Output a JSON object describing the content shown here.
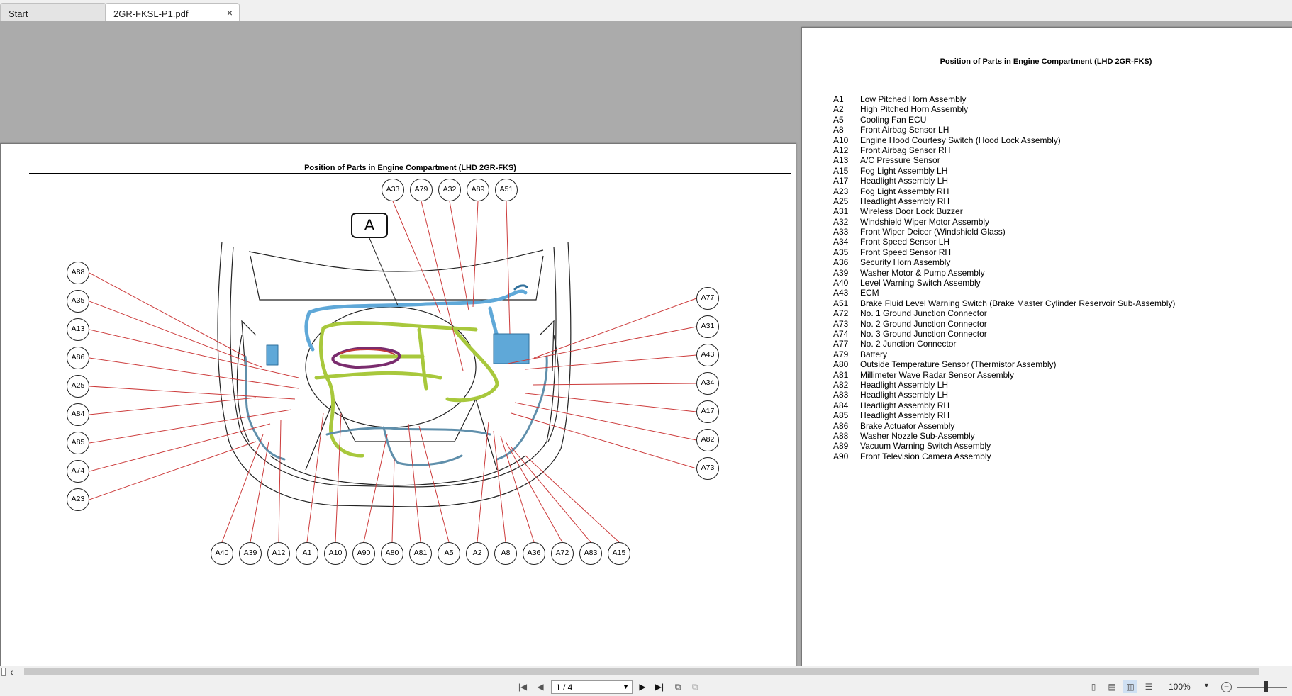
{
  "tabs": [
    {
      "label": "Start"
    },
    {
      "label": "2GR-FKSL-P1.pdf",
      "close": "×"
    }
  ],
  "left_page": {
    "heading": "Position of Parts in Engine Compartment (LHD 2GR-FKS)",
    "view_label": "A",
    "callouts": {
      "top": [
        "A33",
        "A79",
        "A32",
        "A89",
        "A51"
      ],
      "left": [
        "A88",
        "A35",
        "A13",
        "A86",
        "A25",
        "A84",
        "A85",
        "A74",
        "A23"
      ],
      "right": [
        "A77",
        "A31",
        "A43",
        "A34",
        "A17",
        "A82",
        "A73"
      ],
      "bottom": [
        "A40",
        "A39",
        "A12",
        "A1",
        "A10",
        "A90",
        "A80",
        "A81",
        "A5",
        "A2",
        "A8",
        "A36",
        "A72",
        "A83",
        "A15"
      ]
    }
  },
  "right_page": {
    "heading": "Position of Parts in Engine Compartment (LHD 2GR-FKS)",
    "legend": [
      {
        "code": "A1",
        "name": "Low Pitched Horn Assembly"
      },
      {
        "code": "A2",
        "name": "High Pitched Horn Assembly"
      },
      {
        "code": "A5",
        "name": "Cooling Fan ECU"
      },
      {
        "code": "A8",
        "name": "Front Airbag Sensor LH"
      },
      {
        "code": "A10",
        "name": "Engine Hood Courtesy Switch (Hood Lock Assembly)"
      },
      {
        "code": "A12",
        "name": "Front Airbag Sensor RH"
      },
      {
        "code": "A13",
        "name": "A/C Pressure Sensor"
      },
      {
        "code": "A15",
        "name": "Fog Light Assembly LH"
      },
      {
        "code": "A17",
        "name": "Headlight Assembly LH"
      },
      {
        "code": "A23",
        "name": "Fog Light Assembly RH"
      },
      {
        "code": "A25",
        "name": "Headlight Assembly RH"
      },
      {
        "code": "A31",
        "name": "Wireless Door Lock Buzzer"
      },
      {
        "code": "A32",
        "name": "Windshield Wiper Motor Assembly"
      },
      {
        "code": "A33",
        "name": "Front Wiper Deicer (Windshield Glass)"
      },
      {
        "code": "A34",
        "name": "Front Speed Sensor LH"
      },
      {
        "code": "A35",
        "name": "Front Speed Sensor RH"
      },
      {
        "code": "A36",
        "name": "Security Horn Assembly"
      },
      {
        "code": "A39",
        "name": "Washer Motor & Pump Assembly"
      },
      {
        "code": "A40",
        "name": "Level Warning Switch Assembly"
      },
      {
        "code": "A43",
        "name": "ECM"
      },
      {
        "code": "A51",
        "name": "Brake Fluid Level Warning Switch (Brake Master Cylinder Reservoir Sub-Assembly)"
      },
      {
        "code": "A72",
        "name": "No. 1 Ground Junction Connector"
      },
      {
        "code": "A73",
        "name": "No. 2 Ground Junction Connector"
      },
      {
        "code": "A74",
        "name": "No. 3 Ground Junction Connector"
      },
      {
        "code": "A77",
        "name": "No. 2 Junction Connector"
      },
      {
        "code": "A79",
        "name": "Battery"
      },
      {
        "code": "A80",
        "name": "Outside Temperature Sensor (Thermistor Assembly)"
      },
      {
        "code": "A81",
        "name": "Millimeter Wave Radar Sensor Assembly"
      },
      {
        "code": "A82",
        "name": "Headlight Assembly LH"
      },
      {
        "code": "A83",
        "name": "Headlight Assembly LH"
      },
      {
        "code": "A84",
        "name": "Headlight Assembly RH"
      },
      {
        "code": "A85",
        "name": "Headlight Assembly RH"
      },
      {
        "code": "A86",
        "name": "Brake Actuator Assembly"
      },
      {
        "code": "A88",
        "name": "Washer Nozzle Sub-Assembly"
      },
      {
        "code": "A89",
        "name": "Vacuum Warning Switch Assembly"
      },
      {
        "code": "A90",
        "name": "Front Television Camera Assembly"
      }
    ]
  },
  "statusbar": {
    "page_indicator": "1 / 4",
    "zoom": "100%"
  },
  "colors": {
    "leader_line": "#cc3b3b",
    "harness_green": "#a8c83c",
    "harness_blue": "#5fa8d8",
    "harness_purple": "#7a2c6e",
    "chrome": "#f0f0f0",
    "desk": "#ababab"
  },
  "icons": {
    "first_page": "first-page-icon",
    "prev_page": "prev-page-icon",
    "next_page": "next-page-icon",
    "last_page": "last-page-icon"
  }
}
